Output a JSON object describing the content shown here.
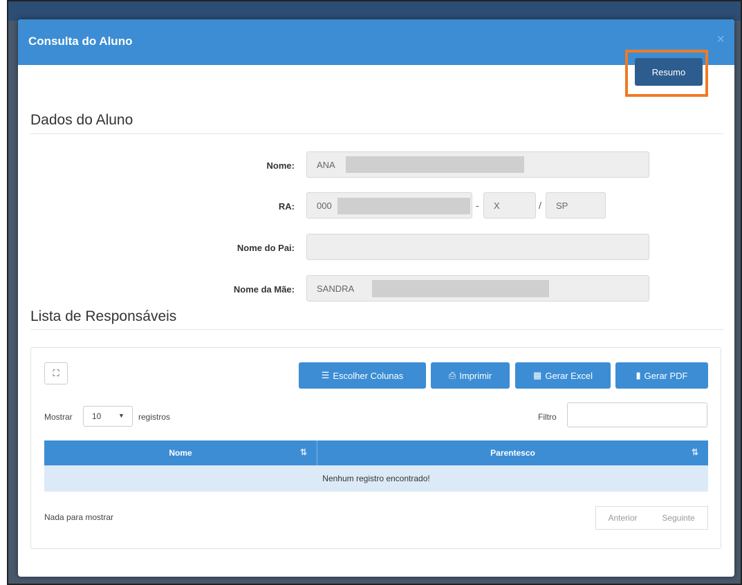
{
  "modal": {
    "title": "Consulta do Aluno",
    "close_icon": "×",
    "resumo_label": "Resumo"
  },
  "dados": {
    "section_title": "Dados do Aluno",
    "nome_label": "Nome:",
    "nome_value": "ANA",
    "ra_label": "RA:",
    "ra_value": "000",
    "ra_digit": "X",
    "ra_sep_dash": "-",
    "ra_sep_slash": "/",
    "ra_uf": "SP",
    "pai_label": "Nome do Pai:",
    "pai_value": "",
    "mae_label": "Nome da Mãe:",
    "mae_value": "SANDRA"
  },
  "responsaveis": {
    "section_title": "Lista de Responsáveis",
    "expand_icon": "expand-icon",
    "buttons": {
      "colunas": "Escolher Colunas",
      "imprimir": "Imprimir",
      "excel": "Gerar Excel",
      "pdf": "Gerar PDF"
    },
    "mostrar_label": "Mostrar",
    "page_size": "10",
    "registros_label": "registros",
    "filtro_label": "Filtro",
    "filtro_value": "",
    "columns": [
      "Nome",
      "Parentesco"
    ],
    "empty_message": "Nenhum registro encontrado!",
    "info": "Nada para mostrar",
    "prev_label": "Anterior",
    "next_label": "Seguinte"
  },
  "colors": {
    "header_blue": "#3c8dd4",
    "resumo_blue": "#2d5d8f",
    "highlight_orange": "#f07a24",
    "empty_row": "#dce9f7"
  }
}
